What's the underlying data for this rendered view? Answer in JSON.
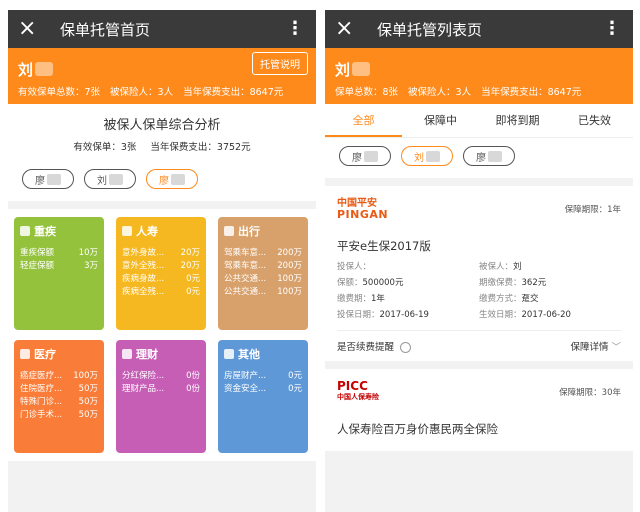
{
  "left": {
    "topbar": {
      "close_icon": "×",
      "title": "保单托管首页",
      "menu_icon": "⋮"
    },
    "header": {
      "user_name": "刘",
      "help_button": "托管说明",
      "stats": [
        "有效保单总数：7张",
        "被保险人：3人",
        "当年保费支出：8647元"
      ]
    },
    "analysis": {
      "title": "被保人保单综合分析",
      "valid": "有效保单：3张",
      "premium": "当年保费支出：3752元"
    },
    "chips": [
      "廖",
      "刘",
      "廖"
    ],
    "categories": [
      {
        "title": "重疾",
        "icon": "hospital-icon",
        "color": "#95c23d",
        "rows": [
          [
            "重疾保额",
            "10万"
          ],
          [
            "轻症保额",
            "3万"
          ]
        ]
      },
      {
        "title": "人寿",
        "icon": "leaf-icon",
        "color": "#f6b820",
        "rows": [
          [
            "意外身故...",
            "20万"
          ],
          [
            "意外全残...",
            "20万"
          ],
          [
            "疾病身故...",
            "0元"
          ],
          [
            "疾病全残...",
            "0元"
          ]
        ]
      },
      {
        "title": "出行",
        "icon": "plane-icon",
        "color": "#d8a16b",
        "rows": [
          [
            "驾乘车意...",
            "200万"
          ],
          [
            "驾乘车意...",
            "200万"
          ],
          [
            "公共交通...",
            "100万"
          ],
          [
            "公共交通...",
            "100万"
          ]
        ]
      },
      {
        "title": "医疗",
        "icon": "medical-icon",
        "color": "#f97c38",
        "rows": [
          [
            "癌症医疗...",
            "100万"
          ],
          [
            "住院医疗...",
            "50万"
          ],
          [
            "特殊门诊...",
            "50万"
          ],
          [
            "门诊手术...",
            "50万"
          ]
        ]
      },
      {
        "title": "理财",
        "icon": "wallet-icon",
        "color": "#c65eb6",
        "rows": [
          [
            "分红保险...",
            "0份"
          ],
          [
            "理财产品...",
            "0份"
          ]
        ]
      },
      {
        "title": "其他",
        "icon": "grid-icon",
        "color": "#5f98d7",
        "rows": [
          [
            "房屋财产...",
            "0元"
          ],
          [
            "资金安全...",
            "0元"
          ]
        ]
      }
    ]
  },
  "right": {
    "topbar": {
      "close_icon": "×",
      "title": "保单托管列表页",
      "menu_icon": "⋮"
    },
    "header": {
      "user_name": "刘",
      "stats": [
        "保单总数：8张",
        "被保险人：3人",
        "当年保费支出：8647元"
      ]
    },
    "tabs": [
      "全部",
      "保障中",
      "即将到期",
      "已失效"
    ],
    "chips": [
      "廖",
      "刘",
      "廖"
    ],
    "policy1": {
      "logo_cn": "中国平安",
      "logo_en": "PINGAN",
      "term": "保障期限：1年",
      "name": "平安e生保2017版",
      "fields": [
        [
          "投保人：",
          ""
        ],
        [
          "被保人：",
          "刘"
        ],
        [
          "保额：",
          "500000元"
        ],
        [
          "期缴保费：",
          "362元"
        ],
        [
          "缴费期：",
          "1年"
        ],
        [
          "缴费方式：",
          "趸交"
        ],
        [
          "投保日期：",
          "2017-06-19"
        ],
        [
          "生效日期：",
          "2017-06-20"
        ]
      ],
      "renew_label": "是否续费提醒",
      "detail_label": "保障详情",
      "chevron": "﹀"
    },
    "policy2": {
      "logo": "PICC",
      "logo_sub": "中国人保寿险",
      "term": "保障期限：30年",
      "name": "人保寿险百万身价惠民两全保险"
    }
  }
}
